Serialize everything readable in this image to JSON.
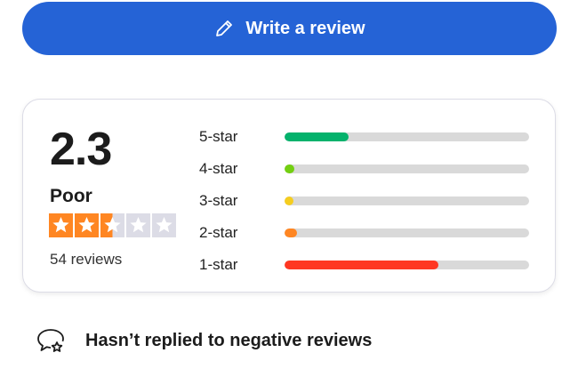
{
  "write_review": {
    "label": "Write a review",
    "icon": "pencil-icon",
    "color": "#2563d6"
  },
  "summary": {
    "score": "2.3",
    "rating_word": "Poor",
    "stars_filled": 2.5,
    "stars_total": 5,
    "star_color": "#ff8622",
    "star_empty_color": "#dcdce6",
    "review_count": "54 reviews"
  },
  "distribution": [
    {
      "label": "5-star",
      "fraction": 0.26,
      "color": "#04b26c"
    },
    {
      "label": "4-star",
      "fraction": 0.04,
      "color": "#73cf11"
    },
    {
      "label": "3-star",
      "fraction": 0.02,
      "color": "#f5cd1f"
    },
    {
      "label": "2-star",
      "fraction": 0.05,
      "color": "#ff8622"
    },
    {
      "label": "1-star",
      "fraction": 0.63,
      "color": "#ff3722"
    }
  ],
  "reply_status": {
    "text": "Hasn’t replied to negative reviews",
    "icon": "speech-bubble-star-icon"
  }
}
